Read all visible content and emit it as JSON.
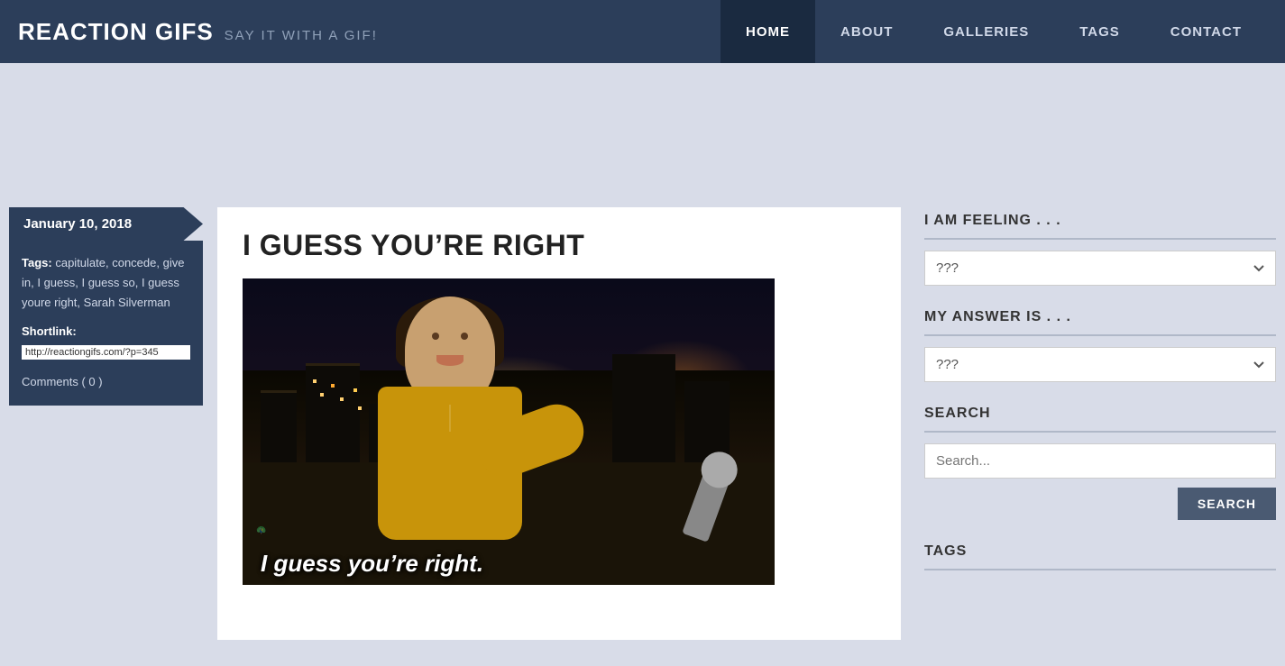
{
  "site": {
    "logo": "REACTION GIFS",
    "tagline": "SAY IT WITH A GIF!",
    "accent_color": "#2c3e5a"
  },
  "nav": {
    "items": [
      {
        "id": "home",
        "label": "HOME",
        "active": true
      },
      {
        "id": "about",
        "label": "ABOUT",
        "active": false
      },
      {
        "id": "galleries",
        "label": "GALLERIES",
        "active": false
      },
      {
        "id": "tags",
        "label": "TAGS",
        "active": false
      },
      {
        "id": "contact",
        "label": "CONTACT",
        "active": false
      }
    ]
  },
  "post": {
    "date": "January 10, 2018",
    "title": "I GUESS YOU’RE RIGHT",
    "tags_label": "Tags:",
    "tags": "capitulate, concede, give in, I guess, I guess so, I guess youre right, Sarah Silverman",
    "shortlink_label": "Shortlink:",
    "shortlink_value": "http://reactiongifs.com/?p=345",
    "comments_label": "Comments ( 0 )",
    "gif_caption": "I guess you’re right."
  },
  "sidebar": {
    "feeling_title": "I AM FEELING . . .",
    "feeling_default": "???",
    "feeling_options": [
      "???"
    ],
    "answer_title": "MY ANSWER IS . . .",
    "answer_default": "???",
    "answer_options": [
      "???"
    ],
    "search_title": "SEARCH",
    "search_placeholder": "Search...",
    "search_button_label": "SEARCH",
    "tags_title": "TAGS"
  }
}
